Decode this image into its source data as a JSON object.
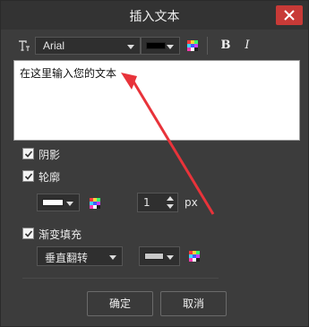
{
  "dialog": {
    "title": "插入文本",
    "close_icon": "close-icon"
  },
  "toolbar": {
    "font_icon": "text-font-icon",
    "font_family": "Arial",
    "text_color": "#000000",
    "palette_icon": "color-palette-icon",
    "bold_label": "B",
    "italic_label": "I"
  },
  "editor": {
    "value": "在这里输入您的文本"
  },
  "options": {
    "shadow_label": "阴影",
    "shadow_checked": true,
    "outline_label": "轮廓",
    "outline_checked": true,
    "outline_color": "#ffffff",
    "outline_width": "1",
    "outline_unit": "px",
    "gradient_label": "渐变填充",
    "gradient_checked": true,
    "gradient_direction": "垂直翻转",
    "gradient_color": "#c8c8c8"
  },
  "buttons": {
    "ok_label": "确定",
    "cancel_label": "取消"
  },
  "annotation": {
    "arrow_color": "#e8333a"
  }
}
